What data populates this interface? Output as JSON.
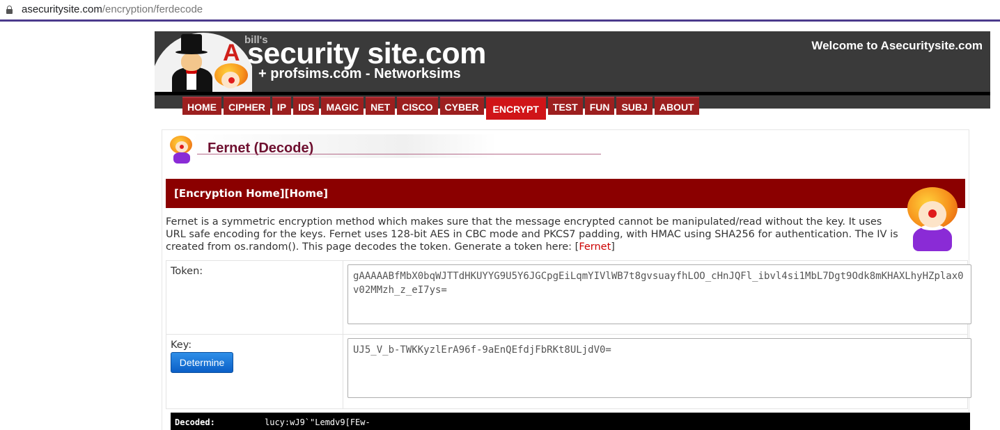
{
  "browser": {
    "url_domain": "asecuritysite.com",
    "url_path": "/encryption/ferdecode"
  },
  "header": {
    "logo_bills": "bill's",
    "logo_letter": "A",
    "logo_main": "security site.com",
    "logo_sub": "+ profsims.com - Networksims",
    "welcome": "Welcome to Asecuritysite.com"
  },
  "nav": {
    "items": [
      "HOME",
      "CIPHER",
      "IP",
      "IDS",
      "MAGIC",
      "NET",
      "CISCO",
      "CYBER",
      "ENCRYPT",
      "TEST",
      "FUN",
      "SUBJ",
      "ABOUT"
    ],
    "active": "ENCRYPT"
  },
  "page": {
    "title": "Fernet (Decode)",
    "breadcrumb": "[Encryption Home][Home]",
    "description": "Fernet is a symmetric encryption method which makes sure that the message encrypted cannot be manipulated/read without the key. It uses URL safe encoding for the keys. Fernet uses 128-bit AES in CBC mode and PKCS7 padding, with HMAC using SHA256 for authentication. The IV is created from os.random(). This page decodes the token. Generate a token here: ",
    "desc_link_open": "[",
    "desc_link": "Fernet",
    "desc_link_close": "]"
  },
  "form": {
    "token_label": "Token:",
    "token_value": "gAAAAABfMbX0bqWJTTdHKUYYG9U5Y6JGCpgEiLqmYIVlWB7t8gvsuayfhLOO_cHnJQFl_ibvl4si1MbL7Dgt9Odk8mKHAXLhyHZplax0v02MMzh_z_eI7ys=",
    "key_label": "Key:",
    "key_value": "UJ5_V_b-TWKKyzlErA96f-9aEnQEfdjFbRKt8ULjdV0=",
    "determine_label": "Determine"
  },
  "output": {
    "label": "Decoded:",
    "value": "lucy:wJ9`\"Lemdv9[FEw-"
  },
  "colors": {
    "nav_bg": "#9c1f1f",
    "nav_active": "#d01418",
    "banner_bg": "#3a3a3a",
    "redbar": "#8b0000",
    "title": "#6e0f2f",
    "button": "#0b5fc7"
  }
}
